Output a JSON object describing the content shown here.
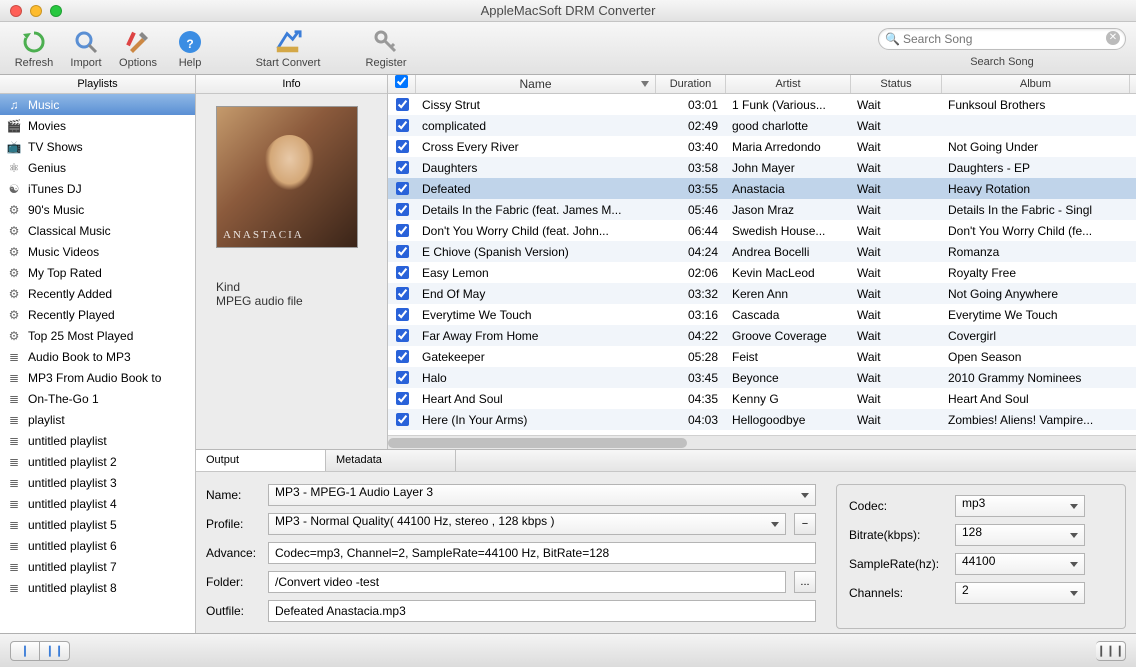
{
  "window": {
    "title": "AppleMacSoft DRM Converter"
  },
  "toolbar": {
    "refresh": "Refresh",
    "import": "Import",
    "options": "Options",
    "help": "Help",
    "start_convert": "Start Convert",
    "register": "Register",
    "search_placeholder": "Search Song",
    "search_label": "Search Song"
  },
  "sidebar": {
    "header": "Playlists",
    "items": [
      {
        "icon": "music",
        "label": "Music",
        "sel": true
      },
      {
        "icon": "movie",
        "label": "Movies"
      },
      {
        "icon": "tv",
        "label": "TV Shows"
      },
      {
        "icon": "genius",
        "label": "Genius"
      },
      {
        "icon": "dj",
        "label": "iTunes DJ"
      },
      {
        "icon": "gear",
        "label": "90's Music"
      },
      {
        "icon": "gear",
        "label": "Classical Music"
      },
      {
        "icon": "gear",
        "label": "Music Videos"
      },
      {
        "icon": "gear",
        "label": "My Top Rated"
      },
      {
        "icon": "gear",
        "label": "Recently Added"
      },
      {
        "icon": "gear",
        "label": "Recently Played"
      },
      {
        "icon": "gear",
        "label": "Top 25 Most Played"
      },
      {
        "icon": "list",
        "label": "Audio Book to MP3"
      },
      {
        "icon": "list",
        "label": "MP3 From Audio Book to"
      },
      {
        "icon": "list",
        "label": "On-The-Go 1"
      },
      {
        "icon": "list",
        "label": "playlist"
      },
      {
        "icon": "list",
        "label": "untitled playlist"
      },
      {
        "icon": "list",
        "label": "untitled playlist 2"
      },
      {
        "icon": "list",
        "label": "untitled playlist 3"
      },
      {
        "icon": "list",
        "label": "untitled playlist 4"
      },
      {
        "icon": "list",
        "label": "untitled playlist 5"
      },
      {
        "icon": "list",
        "label": "untitled playlist 6"
      },
      {
        "icon": "list",
        "label": "untitled playlist 7"
      },
      {
        "icon": "list",
        "label": "untitled playlist 8"
      }
    ]
  },
  "info": {
    "header": "Info",
    "kind_label": "Kind",
    "kind_value": "MPEG audio file"
  },
  "songs": {
    "columns": {
      "name": "Name",
      "duration": "Duration",
      "artist": "Artist",
      "status": "Status",
      "album": "Album"
    },
    "rows": [
      {
        "name": "Cissy Strut",
        "dur": "03:01",
        "art": "1 Funk (Various...",
        "stat": "Wait",
        "alb": "Funksoul Brothers"
      },
      {
        "name": "complicated",
        "dur": "02:49",
        "art": "good charlotte",
        "stat": "Wait",
        "alb": ""
      },
      {
        "name": "Cross Every River",
        "dur": "03:40",
        "art": "Maria Arredondo",
        "stat": "Wait",
        "alb": "Not Going Under"
      },
      {
        "name": "Daughters",
        "dur": "03:58",
        "art": "John Mayer",
        "stat": "Wait",
        "alb": "Daughters - EP"
      },
      {
        "name": "Defeated",
        "dur": "03:55",
        "art": "Anastacia",
        "stat": "Wait",
        "alb": "Heavy Rotation",
        "sel": true
      },
      {
        "name": "Details In the Fabric (feat. James M...",
        "dur": "05:46",
        "art": "Jason Mraz",
        "stat": "Wait",
        "alb": "Details In the Fabric - Singl"
      },
      {
        "name": "Don't You Worry Child (feat. John...",
        "dur": "06:44",
        "art": "Swedish House...",
        "stat": "Wait",
        "alb": "Don't You Worry Child (fe..."
      },
      {
        "name": "E Chiove (Spanish Version)",
        "dur": "04:24",
        "art": "Andrea Bocelli",
        "stat": "Wait",
        "alb": "Romanza"
      },
      {
        "name": "Easy Lemon",
        "dur": "02:06",
        "art": "Kevin MacLeod",
        "stat": "Wait",
        "alb": "Royalty Free"
      },
      {
        "name": "End Of May",
        "dur": "03:32",
        "art": "Keren Ann",
        "stat": "Wait",
        "alb": "Not Going Anywhere"
      },
      {
        "name": "Everytime We Touch",
        "dur": "03:16",
        "art": "Cascada",
        "stat": "Wait",
        "alb": "Everytime We Touch"
      },
      {
        "name": "Far Away From Home",
        "dur": "04:22",
        "art": "Groove Coverage",
        "stat": "Wait",
        "alb": "Covergirl"
      },
      {
        "name": "Gatekeeper",
        "dur": "05:28",
        "art": "Feist",
        "stat": "Wait",
        "alb": "Open Season"
      },
      {
        "name": "Halo",
        "dur": "03:45",
        "art": "Beyonce",
        "stat": "Wait",
        "alb": "2010 Grammy Nominees"
      },
      {
        "name": "Heart And Soul",
        "dur": "04:35",
        "art": "Kenny G",
        "stat": "Wait",
        "alb": "Heart And Soul"
      },
      {
        "name": "Here (In Your Arms)",
        "dur": "04:03",
        "art": "Hellogoodbye",
        "stat": "Wait",
        "alb": "Zombies! Aliens! Vampire..."
      }
    ]
  },
  "output": {
    "tab_output": "Output",
    "tab_metadata": "Metadata",
    "name_label": "Name:",
    "name_value": "MP3 - MPEG-1 Audio Layer 3",
    "profile_label": "Profile:",
    "profile_value": "MP3 - Normal Quality( 44100 Hz, stereo , 128 kbps )",
    "advance_label": "Advance:",
    "advance_value": "Codec=mp3, Channel=2, SampleRate=44100 Hz, BitRate=128",
    "folder_label": "Folder:",
    "folder_value": "/Convert video -test",
    "outfile_label": "Outfile:",
    "outfile_value": "Defeated Anastacia.mp3",
    "codec_label": "Codec:",
    "codec_value": "mp3",
    "bitrate_label": "Bitrate(kbps):",
    "bitrate_value": "128",
    "samplerate_label": "SampleRate(hz):",
    "samplerate_value": "44100",
    "channels_label": "Channels:",
    "channels_value": "2"
  }
}
